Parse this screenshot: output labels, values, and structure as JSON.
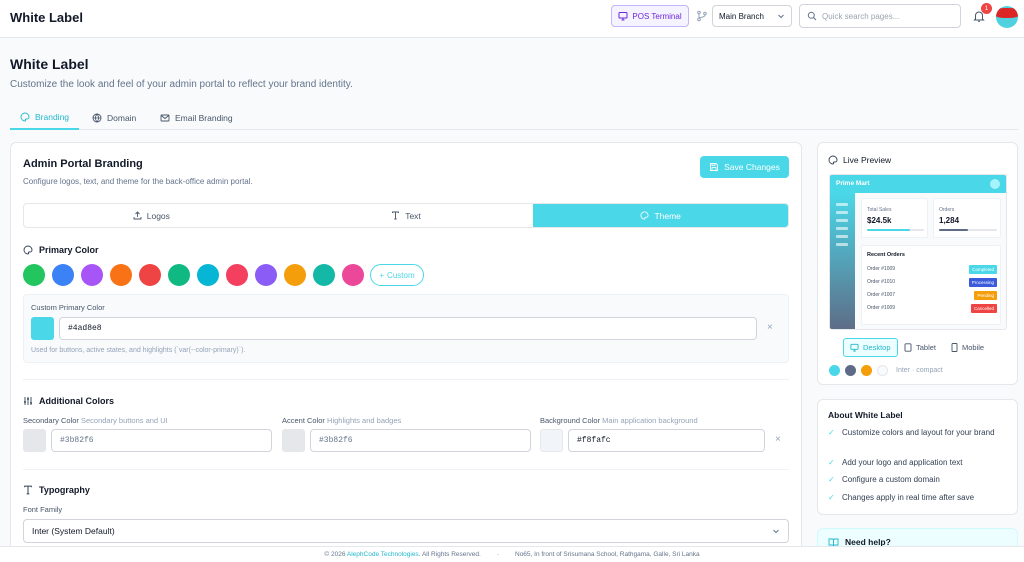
{
  "app": {
    "title": "White Label"
  },
  "topbar": {
    "pos_label": "POS Terminal",
    "branch_value": "Main Branch",
    "search_placeholder": "Quick search pages...",
    "notification_count": "1"
  },
  "page": {
    "title": "White Label",
    "subtitle": "Customize the look and feel of your admin portal to reflect your brand identity."
  },
  "tabs": [
    {
      "label": "Branding",
      "active": true
    },
    {
      "label": "Domain"
    },
    {
      "label": "Email Branding"
    }
  ],
  "branding": {
    "title": "Admin Portal Branding",
    "subtitle": "Configure logos, text, and theme for the back-office admin portal.",
    "save_label": "Save Changes",
    "segments": [
      {
        "label": "Logos"
      },
      {
        "label": "Text"
      },
      {
        "label": "Theme",
        "active": true
      }
    ]
  },
  "primary": {
    "title": "Primary Color",
    "palette": [
      "#22c55e",
      "#3b82f6",
      "#a855f7",
      "#f97316",
      "#ef4444",
      "#10b981",
      "#06b6d4",
      "#f43f5e",
      "#8b5cf6",
      "#f59e0b",
      "#14b8a6",
      "#ec4899"
    ],
    "custom_label": "Custom",
    "custom_title": "Custom Primary Color",
    "custom_value": "#4ad8e8",
    "hint": "Used for buttons, active states, and highlights (`var(--color-primary)`)."
  },
  "additional": {
    "title": "Additional Colors",
    "fields": [
      {
        "label": "Secondary Color",
        "hint": "Secondary buttons and UI",
        "value": "#3b82f6",
        "chip": "#e5e7eb"
      },
      {
        "label": "Accent Color",
        "hint": "Highlights and badges",
        "value": "#3b82f6",
        "chip": "#e5e7eb"
      },
      {
        "label": "Background Color",
        "hint": "Main application background",
        "value": "#f8fafc",
        "chip": "#f1f5f9"
      }
    ]
  },
  "typography": {
    "title": "Typography",
    "font_label": "Font Family",
    "font_value": "Inter (System Default)"
  },
  "preview": {
    "title": "Live Preview",
    "brand": "Prime Mart",
    "stats": [
      {
        "label": "Total Sales",
        "value": "$24.5k",
        "progress": 0.75,
        "color": "#4ad8e8"
      },
      {
        "label": "Orders",
        "value": "1,284",
        "progress": 0.5,
        "color": "#5e6b86"
      }
    ],
    "orders_title": "Recent Orders",
    "orders": [
      {
        "id": "Order #1009",
        "status": "Completed",
        "color": "#4ad8e8"
      },
      {
        "id": "Order #1010",
        "status": "Processing",
        "color": "#3b5bdb"
      },
      {
        "id": "Order #1007",
        "status": "Pending",
        "color": "#f59e0b"
      },
      {
        "id": "Order #1009",
        "status": "Cancelled",
        "color": "#ef4444"
      }
    ],
    "devices": [
      {
        "label": "Desktop",
        "active": true
      },
      {
        "label": "Tablet"
      },
      {
        "label": "Mobile"
      }
    ],
    "dots": [
      "#4ad8e8",
      "#5e6b86",
      "#f59e0b",
      "#f8fafc"
    ],
    "font_note": "Inter · compact"
  },
  "about": {
    "title": "About White Label",
    "items": [
      "Customize colors and layout for your brand",
      "Add your logo and application text",
      "Configure a custom domain",
      "Changes apply in real time after save"
    ]
  },
  "help": {
    "title": "Need help?"
  },
  "footer": {
    "copyright_prefix": "© 2026",
    "company": "AlephCode Technologies",
    "copyright_suffix": ". All Rights Reserved.",
    "address": "No65, In front of Srisumana School, Rathgama, Galle, Sri Lanka"
  }
}
